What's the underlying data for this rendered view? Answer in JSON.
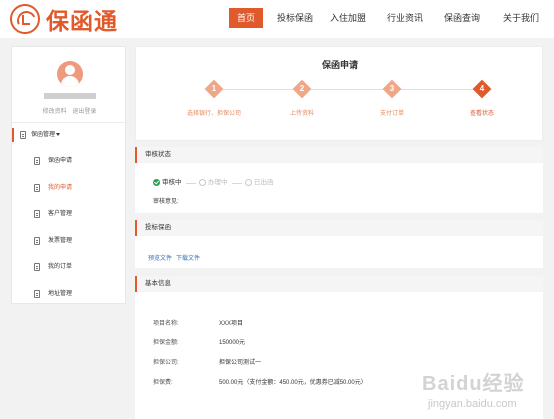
{
  "header": {
    "logo_text": "保函通",
    "nav": [
      {
        "label": "首页",
        "active": true
      },
      {
        "label": "投标保函",
        "active": false
      },
      {
        "label": "入住加盟",
        "active": false
      },
      {
        "label": "行业资讯",
        "active": false
      },
      {
        "label": "保函查询",
        "active": false
      },
      {
        "label": "关于我们",
        "active": false
      }
    ]
  },
  "sidebar": {
    "user_links": [
      "修改资料",
      "退出登录"
    ],
    "group_label": "保函管理",
    "items": [
      {
        "label": "保函申请",
        "active": false
      },
      {
        "label": "我的申请",
        "active": true
      },
      {
        "label": "客户管理",
        "active": false
      },
      {
        "label": "发票管理",
        "active": false
      },
      {
        "label": "我的订单",
        "active": false
      },
      {
        "label": "地址管理",
        "active": false
      }
    ]
  },
  "main": {
    "title": "保函申请",
    "steps": [
      {
        "num": "1",
        "label": "选择银行、担保公司"
      },
      {
        "num": "2",
        "label": "上传资料"
      },
      {
        "num": "3",
        "label": "支付订单"
      },
      {
        "num": "4",
        "label": "查看状态"
      }
    ],
    "current_step": 4,
    "audit": {
      "section_title": "审核状态",
      "statuses": [
        {
          "label": "审核中",
          "done": true
        },
        {
          "label": "办理中",
          "done": false
        },
        {
          "label": "已出函",
          "done": false
        }
      ],
      "remark_label": "审核意见:"
    },
    "guarantee": {
      "section_title": "投标保函",
      "links": [
        "预览文件",
        "下载文件"
      ]
    },
    "basic_info": {
      "section_title": "基本信息",
      "rows": [
        {
          "label": "项目名称:",
          "value": "XXX项目"
        },
        {
          "label": "担保金额:",
          "value": "150000元"
        },
        {
          "label": "担保公司:",
          "value": "担保公司测试一"
        },
        {
          "label": "担保费:",
          "value": "500.00元（支付金额：450.00元，优惠券已减50.00元）"
        }
      ]
    }
  },
  "watermark": {
    "main": "Baidu经验",
    "sub": "jingyan.baidu.com"
  },
  "colors": {
    "accent": "#e05a2b",
    "accent_light": "#efa788",
    "link": "#3a6fb7",
    "success": "#2e9c53"
  }
}
